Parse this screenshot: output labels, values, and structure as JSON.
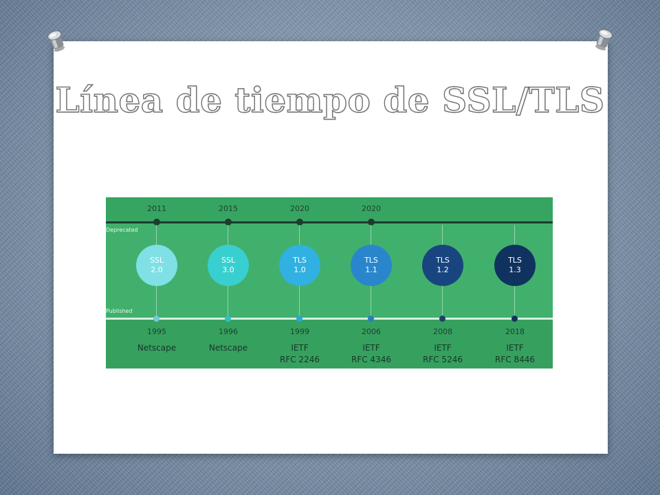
{
  "slide": {
    "title": "Línea de tiempo de SSL/TLS"
  },
  "timeline": {
    "deprecated_label": "Deprecated",
    "published_label": "Published",
    "items": [
      {
        "protocol": "SSL",
        "version": "2.0",
        "deprecated_year": "2011",
        "published_year": "1995",
        "publisher": "Netscape",
        "rfc": "",
        "color": "#7fe0e6",
        "dot_color": "#6fcbd6"
      },
      {
        "protocol": "SSL",
        "version": "3.0",
        "deprecated_year": "2015",
        "published_year": "1996",
        "publisher": "Netscape",
        "rfc": "",
        "color": "#38cfd0",
        "dot_color": "#34bfc6"
      },
      {
        "protocol": "TLS",
        "version": "1.0",
        "deprecated_year": "2020",
        "published_year": "1999",
        "publisher": "IETF",
        "rfc": "RFC 2246",
        "color": "#31b0e2",
        "dot_color": "#2ea6da"
      },
      {
        "protocol": "TLS",
        "version": "1.1",
        "deprecated_year": "2020",
        "published_year": "2006",
        "publisher": "IETF",
        "rfc": "RFC 4346",
        "color": "#2a86cc",
        "dot_color": "#2a7dc4"
      },
      {
        "protocol": "TLS",
        "version": "1.2",
        "deprecated_year": "",
        "published_year": "2008",
        "publisher": "IETF",
        "rfc": "RFC 5246",
        "color": "#18457f",
        "dot_color": "#1b3f70"
      },
      {
        "protocol": "TLS",
        "version": "1.3",
        "deprecated_year": "",
        "published_year": "2018",
        "publisher": "IETF",
        "rfc": "RFC 8446",
        "color": "#0f325f",
        "dot_color": "#13325a"
      }
    ]
  }
}
